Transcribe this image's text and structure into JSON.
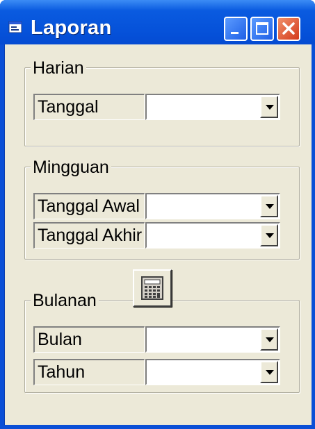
{
  "window": {
    "title": "Laporan"
  },
  "harian": {
    "legend": "Harian",
    "rows": [
      {
        "label": "Tanggal",
        "value": ""
      }
    ]
  },
  "mingguan": {
    "legend": "Mingguan",
    "rows": [
      {
        "label": "Tanggal Awal",
        "value": ""
      },
      {
        "label": "Tanggal Akhir",
        "value": ""
      }
    ]
  },
  "bulanan": {
    "legend": "Bulanan",
    "rows": [
      {
        "label": "Bulan",
        "value": ""
      },
      {
        "label": "Tahun",
        "value": ""
      }
    ]
  },
  "icons": {
    "app": "form-icon",
    "minimize": "minimize-icon",
    "maximize": "maximize-icon",
    "close": "close-icon",
    "dropdown": "chevron-down-icon",
    "calculator": "calculator-icon"
  },
  "colors": {
    "titlebar": "#0550d8",
    "client": "#ece9d8",
    "close": "#d4391a"
  }
}
